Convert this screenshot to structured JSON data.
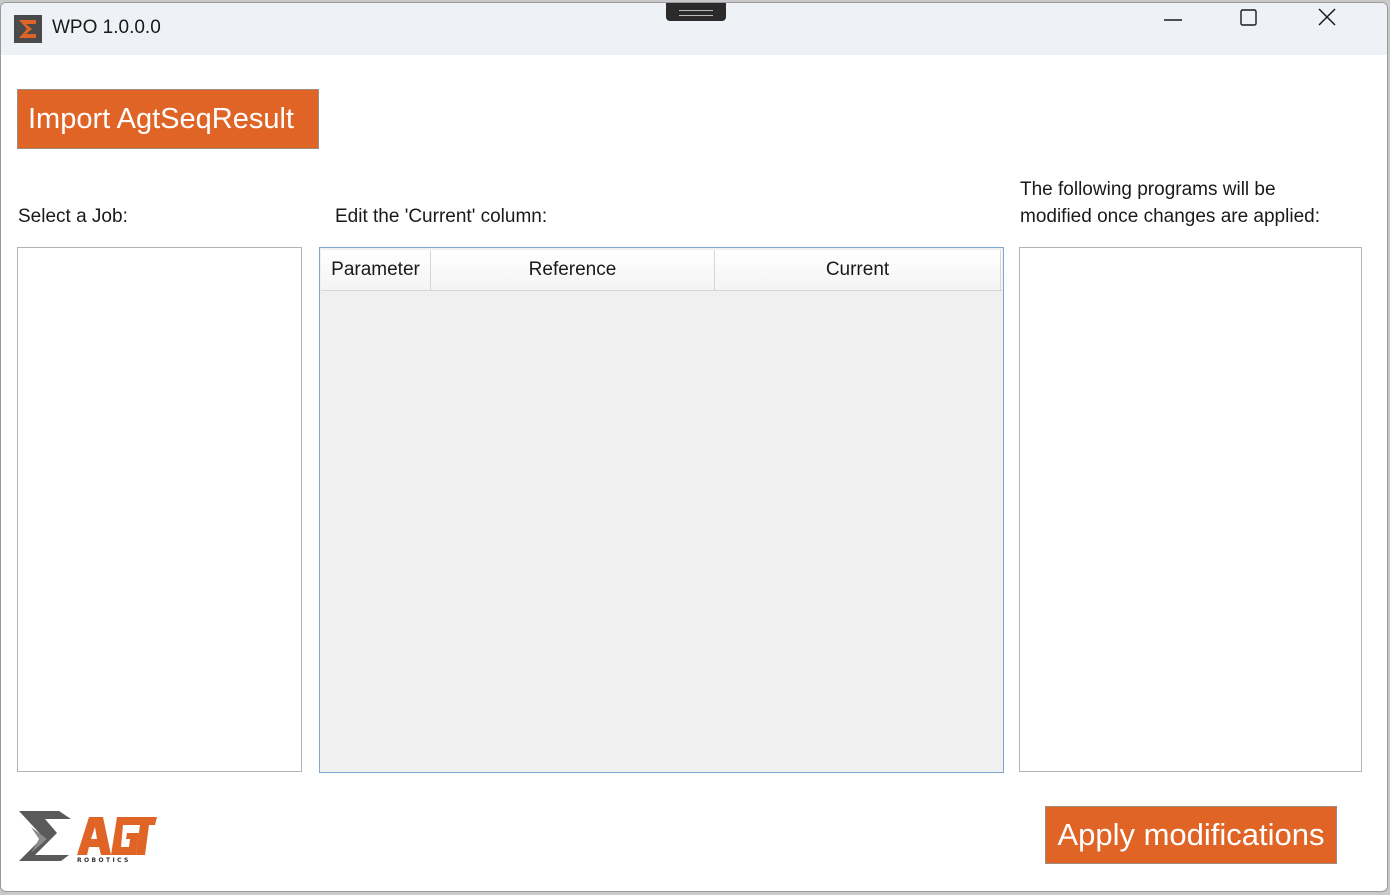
{
  "window": {
    "title": "WPO 1.0.0.0",
    "controls": {
      "minimize_icon": "minimize-icon",
      "maximize_icon": "maximize-icon",
      "close_icon": "close-icon"
    }
  },
  "toolbar": {
    "import_label": "Import AgtSeqResult"
  },
  "jobs": {
    "label": "Select a Job:",
    "items": []
  },
  "editor": {
    "label": "Edit the 'Current' column:",
    "columns": [
      "Parameter",
      "Reference",
      "Current"
    ],
    "rows": []
  },
  "programs": {
    "label_line1": "The following programs will be",
    "label_line2": "modified once changes are applied:",
    "items": []
  },
  "footer": {
    "apply_label": "Apply modifications",
    "logo_text": "AGT",
    "logo_subtext": "ROBOTICS"
  },
  "colors": {
    "accent": "#e06426",
    "titlebar": "#eef1f6",
    "grid_background": "#f0f0f0",
    "grid_border": "#7fa6cf"
  }
}
